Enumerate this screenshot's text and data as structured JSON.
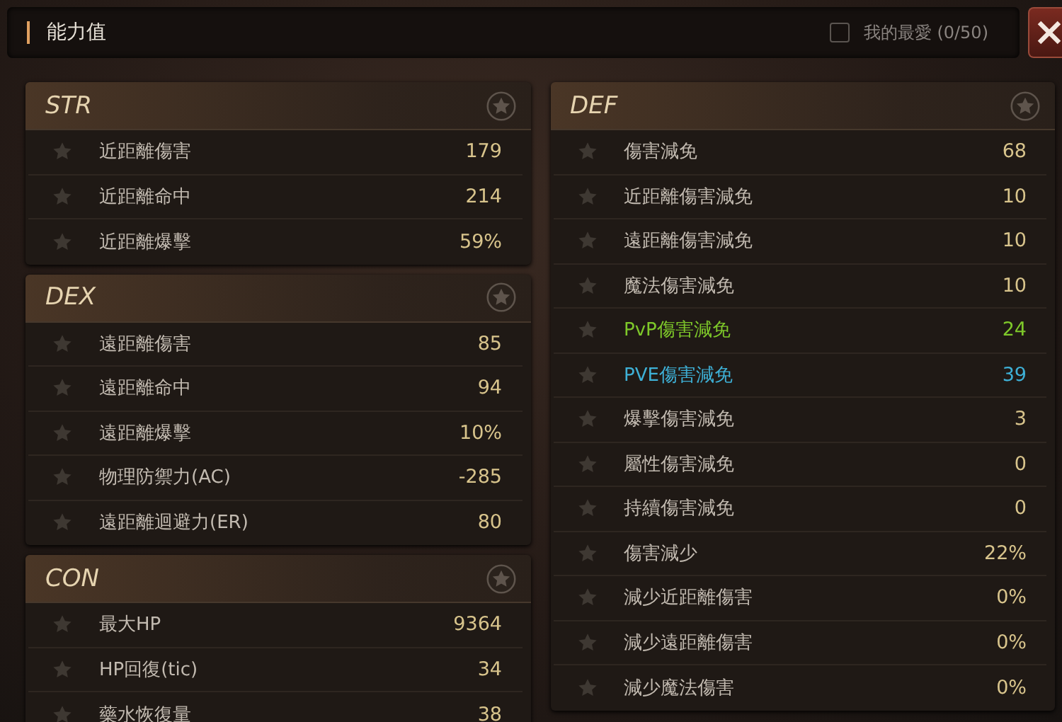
{
  "window": {
    "title": "能力值",
    "favorites": {
      "label": "我的最愛 (0/50)",
      "checked": false
    }
  },
  "columns": [
    {
      "groups": [
        {
          "title": "STR",
          "stats": [
            {
              "label": "近距離傷害",
              "value": "179"
            },
            {
              "label": "近距離命中",
              "value": "214"
            },
            {
              "label": "近距離爆擊",
              "value": "59%"
            }
          ]
        },
        {
          "title": "DEX",
          "stats": [
            {
              "label": "遠距離傷害",
              "value": "85"
            },
            {
              "label": "遠距離命中",
              "value": "94"
            },
            {
              "label": "遠距離爆擊",
              "value": "10%"
            },
            {
              "label": "物理防禦力(AC)",
              "value": "-285"
            },
            {
              "label": "遠距離迴避力(ER)",
              "value": "80"
            }
          ]
        },
        {
          "title": "CON",
          "stats": [
            {
              "label": "最大HP",
              "value": "9364"
            },
            {
              "label": "HP回復(tic)",
              "value": "34"
            },
            {
              "label": "藥水恢復量",
              "value": "38"
            }
          ]
        }
      ]
    },
    {
      "groups": [
        {
          "title": "DEF",
          "stats": [
            {
              "label": "傷害減免",
              "value": "68"
            },
            {
              "label": "近距離傷害減免",
              "value": "10"
            },
            {
              "label": "遠距離傷害減免",
              "value": "10"
            },
            {
              "label": "魔法傷害減免",
              "value": "10"
            },
            {
              "label": "PvP傷害減免",
              "value": "24",
              "color": "#7ec82a"
            },
            {
              "label": "PVE傷害減免",
              "value": "39",
              "color": "#3eb0d6"
            },
            {
              "label": "爆擊傷害減免",
              "value": "3"
            },
            {
              "label": "屬性傷害減免",
              "value": "0"
            },
            {
              "label": "持續傷害減免",
              "value": "0"
            },
            {
              "label": "傷害減少",
              "value": "22%"
            },
            {
              "label": "減少近距離傷害",
              "value": "0%"
            },
            {
              "label": "減少遠距離傷害",
              "value": "0%"
            },
            {
              "label": "減少魔法傷害",
              "value": "0%"
            }
          ]
        }
      ]
    }
  ]
}
